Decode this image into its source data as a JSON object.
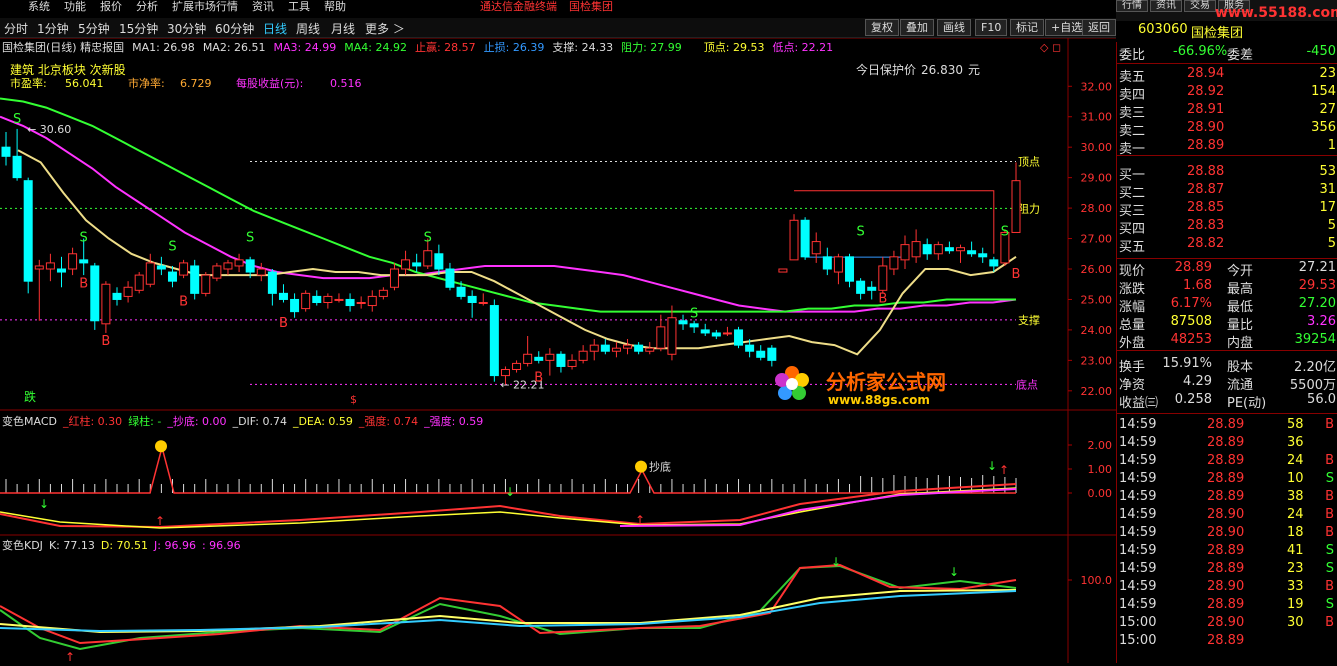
{
  "menu": {
    "items": [
      "系统",
      "功能",
      "报价",
      "分析",
      "扩展市场行情",
      "资讯",
      "工具",
      "帮助"
    ],
    "center_left": "通达信金融终端",
    "center_right": "国检集团"
  },
  "topright": {
    "buttons": [
      "行情",
      "资讯",
      "交易",
      "服务"
    ],
    "url": "www.55188.com"
  },
  "toolbar": {
    "periods": [
      "分时",
      "1分钟",
      "5分钟",
      "15分钟",
      "30分钟",
      "60分钟",
      "日线",
      "周线",
      "月线",
      "更多 ＞"
    ],
    "active": "日线",
    "right_buttons": [
      "复权",
      "叠加",
      "画线",
      "F10",
      "标记",
      "+自选",
      "返回"
    ]
  },
  "stock": {
    "code": "603060",
    "name": "国检集团"
  },
  "main_chart": {
    "legend": [
      {
        "text": "国检集团(日线) 精忠报国",
        "color": "#dddddd"
      },
      {
        "text": "MA1: 26.98",
        "color": "#dddddd"
      },
      {
        "text": "MA2: 26.51",
        "color": "#dddddd"
      },
      {
        "text": "MA3: 24.99",
        "color": "#ff33ff"
      },
      {
        "text": "MA4: 24.92",
        "color": "#33ff33"
      },
      {
        "text": "止赢: 28.57",
        "color": "#ff3333"
      },
      {
        "text": "止损: 26.39",
        "color": "#3399ff"
      },
      {
        "text": "支撑: 24.33",
        "color": "#dddddd"
      },
      {
        "text": "阻力: 27.99",
        "color": "#33ff33"
      },
      {
        "text": "顶点: 29.53",
        "color": "#ffff33"
      },
      {
        "text": "低点: 22.21",
        "color": "#ff33ff"
      }
    ],
    "info_line1": "建筑 北京板块 次新股",
    "pe_label": "市盈率:",
    "pe_value": "56.041",
    "pb_label": "市净率:",
    "pb_value": "6.729",
    "eps_label": "每股收益(元):",
    "eps_value": "0.516",
    "protect_label": "今日保护价",
    "protect_value": "26.830",
    "protect_unit": "元",
    "price_labels": {
      "high": "30.60",
      "low": "22.21",
      "top": "顶点",
      "resist": "阻力",
      "support": "支撑",
      "bottom": "底点"
    },
    "y_ticks": [
      "32.00",
      "31.00",
      "30.00",
      "29.00",
      "28.00",
      "27.00",
      "26.00",
      "25.00",
      "24.00",
      "23.00",
      "22.00"
    ],
    "fall_label": "跌"
  },
  "macd": {
    "legend": [
      {
        "text": "变色MACD",
        "color": "#dddddd"
      },
      {
        "text": "_红柱: 0.30",
        "color": "#ff3333"
      },
      {
        "text": "绿柱: -",
        "color": "#33ff33"
      },
      {
        "text": "_抄底: 0.00",
        "color": "#ff33ff"
      },
      {
        "text": "_DIF: 0.74",
        "color": "#dddddd"
      },
      {
        "text": "_DEA: 0.59",
        "color": "#ffff33"
      },
      {
        "text": "_强度: 0.74",
        "color": "#ff3333"
      },
      {
        "text": "_强度: 0.59",
        "color": "#ff33ff"
      }
    ],
    "y_ticks": [
      "2.00",
      "1.00",
      "0.00"
    ],
    "bottom_label": "抄底"
  },
  "kdj": {
    "legend": [
      {
        "text": "变色KDJ",
        "color": "#dddddd"
      },
      {
        "text": "K: 77.13",
        "color": "#dddddd"
      },
      {
        "text": "D: 70.51",
        "color": "#ffff33"
      },
      {
        "text": "J: 96.96",
        "color": "#ff33ff"
      },
      {
        "text": ": 96.96",
        "color": "#ff33ff"
      }
    ],
    "y_ticks": [
      "100.0"
    ]
  },
  "quote": {
    "ratio_label": "委比",
    "ratio_value": "-66.96%",
    "diff_label": "委差",
    "diff_value": "-450",
    "asks": [
      {
        "label": "卖五",
        "price": "28.94",
        "vol": "23"
      },
      {
        "label": "卖四",
        "price": "28.92",
        "vol": "154"
      },
      {
        "label": "卖三",
        "price": "28.91",
        "vol": "27"
      },
      {
        "label": "卖二",
        "price": "28.90",
        "vol": "356"
      },
      {
        "label": "卖一",
        "price": "28.89",
        "vol": "1"
      }
    ],
    "bids": [
      {
        "label": "买一",
        "price": "28.88",
        "vol": "53"
      },
      {
        "label": "买二",
        "price": "28.87",
        "vol": "31"
      },
      {
        "label": "买三",
        "price": "28.85",
        "vol": "17"
      },
      {
        "label": "买四",
        "price": "28.83",
        "vol": "5"
      },
      {
        "label": "买五",
        "price": "28.82",
        "vol": "5"
      }
    ],
    "stats": [
      {
        "l1": "现价",
        "v1": "28.89",
        "c1": "#ff3333",
        "l2": "今开",
        "v2": "27.21",
        "c2": "#dddddd"
      },
      {
        "l1": "涨跌",
        "v1": "1.68",
        "c1": "#ff3333",
        "l2": "最高",
        "v2": "29.53",
        "c2": "#ff3333"
      },
      {
        "l1": "涨幅",
        "v1": "6.17%",
        "c1": "#ff3333",
        "l2": "最低",
        "v2": "27.20",
        "c2": "#33ff33"
      },
      {
        "l1": "总量",
        "v1": "87508",
        "c1": "#ffff33",
        "l2": "量比",
        "v2": "3.26",
        "c2": "#ff33ff"
      },
      {
        "l1": "外盘",
        "v1": "48253",
        "c1": "#ff3333",
        "l2": "内盘",
        "v2": "39254",
        "c2": "#33ff33"
      }
    ],
    "stats2": [
      {
        "l1": "换手",
        "v1": "15.91%",
        "l2": "股本",
        "v2": "2.20亿"
      },
      {
        "l1": "净资",
        "v1": "4.29",
        "l2": "流通",
        "v2": "5500万"
      },
      {
        "l1": "收益㈢",
        "v1": "0.258",
        "l2": "PE(动)",
        "v2": "56.0"
      }
    ],
    "ticks": [
      {
        "time": "14:59",
        "price": "28.89",
        "vol": "58",
        "side": "B"
      },
      {
        "time": "14:59",
        "price": "28.89",
        "vol": "36",
        "side": ""
      },
      {
        "time": "14:59",
        "price": "28.89",
        "vol": "24",
        "side": "B"
      },
      {
        "time": "14:59",
        "price": "28.89",
        "vol": "10",
        "side": "S"
      },
      {
        "time": "14:59",
        "price": "28.89",
        "vol": "38",
        "side": "B"
      },
      {
        "time": "14:59",
        "price": "28.90",
        "vol": "24",
        "side": "B"
      },
      {
        "time": "14:59",
        "price": "28.90",
        "vol": "18",
        "side": "B"
      },
      {
        "time": "14:59",
        "price": "28.89",
        "vol": "41",
        "side": "S"
      },
      {
        "time": "14:59",
        "price": "28.89",
        "vol": "23",
        "side": "S"
      },
      {
        "time": "14:59",
        "price": "28.90",
        "vol": "33",
        "side": "B"
      },
      {
        "time": "14:59",
        "price": "28.89",
        "vol": "19",
        "side": "S"
      },
      {
        "time": "15:00",
        "price": "28.90",
        "vol": "30",
        "side": "B"
      },
      {
        "time": "15:00",
        "price": "28.89",
        "vol": "",
        "side": ""
      }
    ]
  },
  "watermark": {
    "title": "分析家公式网",
    "url": "www.88gs.com"
  },
  "chart_data": {
    "type": "candlestick",
    "ylim": [
      21.6,
      32.6
    ],
    "candles": [
      [
        30.0,
        30.5,
        29.4,
        29.7
      ],
      [
        29.7,
        30.6,
        28.9,
        29.0
      ],
      [
        28.9,
        29.0,
        25.2,
        25.6
      ],
      [
        26.0,
        26.3,
        24.3,
        26.1
      ],
      [
        26.0,
        26.5,
        25.6,
        26.2
      ],
      [
        26.0,
        26.4,
        25.4,
        25.9
      ],
      [
        26.0,
        26.7,
        25.8,
        26.5
      ],
      [
        26.3,
        27.0,
        25.8,
        26.2
      ],
      [
        26.1,
        26.2,
        24.0,
        24.3
      ],
      [
        24.2,
        25.6,
        23.9,
        25.5
      ],
      [
        25.2,
        25.4,
        24.8,
        25.0
      ],
      [
        25.1,
        25.6,
        24.9,
        25.4
      ],
      [
        25.3,
        25.9,
        25.2,
        25.8
      ],
      [
        25.5,
        26.5,
        25.4,
        26.2
      ],
      [
        26.1,
        26.4,
        25.8,
        26.0
      ],
      [
        25.9,
        26.1,
        25.4,
        25.6
      ],
      [
        25.8,
        26.3,
        25.7,
        26.2
      ],
      [
        26.1,
        26.3,
        25.0,
        25.2
      ],
      [
        25.2,
        25.9,
        25.1,
        25.8
      ],
      [
        25.7,
        26.2,
        25.6,
        26.1
      ],
      [
        26.0,
        26.3,
        25.8,
        26.2
      ],
      [
        26.1,
        26.5,
        25.9,
        26.3
      ],
      [
        26.3,
        26.4,
        25.7,
        25.9
      ],
      [
        25.8,
        26.2,
        25.6,
        26.0
      ],
      [
        25.9,
        26.0,
        24.8,
        25.2
      ],
      [
        25.2,
        25.5,
        24.9,
        25.0
      ],
      [
        25.0,
        25.2,
        24.4,
        24.6
      ],
      [
        24.7,
        25.3,
        24.6,
        25.2
      ],
      [
        25.1,
        25.3,
        24.8,
        24.9
      ],
      [
        24.9,
        25.2,
        24.7,
        25.1
      ],
      [
        25.0,
        25.2,
        24.9,
        25.0
      ],
      [
        25.0,
        25.2,
        24.6,
        24.8
      ],
      [
        24.9,
        25.1,
        24.7,
        24.9
      ],
      [
        24.8,
        25.3,
        24.6,
        25.1
      ],
      [
        25.1,
        25.4,
        25.0,
        25.3
      ],
      [
        25.4,
        26.2,
        25.3,
        26.0
      ],
      [
        26.0,
        26.6,
        25.8,
        26.3
      ],
      [
        26.2,
        26.5,
        25.9,
        26.1
      ],
      [
        26.1,
        27.0,
        26.0,
        26.6
      ],
      [
        26.5,
        26.8,
        25.8,
        26.0
      ],
      [
        26.0,
        26.2,
        25.3,
        25.4
      ],
      [
        25.4,
        25.6,
        25.0,
        25.1
      ],
      [
        25.1,
        25.3,
        24.4,
        24.9
      ],
      [
        24.9,
        25.2,
        24.8,
        24.9
      ],
      [
        24.8,
        25.0,
        22.3,
        22.5
      ],
      [
        22.5,
        22.8,
        22.2,
        22.7
      ],
      [
        22.7,
        23.0,
        22.6,
        22.9
      ],
      [
        22.9,
        23.8,
        22.8,
        23.2
      ],
      [
        23.1,
        23.3,
        22.9,
        23.0
      ],
      [
        23.0,
        23.4,
        22.5,
        23.2
      ],
      [
        23.2,
        23.3,
        22.6,
        22.8
      ],
      [
        22.8,
        23.2,
        22.7,
        23.0
      ],
      [
        23.0,
        23.5,
        22.9,
        23.3
      ],
      [
        23.3,
        23.7,
        23.0,
        23.5
      ],
      [
        23.5,
        23.7,
        23.2,
        23.3
      ],
      [
        23.3,
        23.6,
        23.1,
        23.4
      ],
      [
        23.4,
        23.7,
        23.2,
        23.5
      ],
      [
        23.5,
        23.6,
        23.2,
        23.3
      ],
      [
        23.3,
        23.6,
        23.2,
        23.4
      ],
      [
        23.4,
        24.5,
        23.3,
        24.1
      ],
      [
        23.2,
        24.8,
        23.0,
        24.4
      ],
      [
        24.3,
        24.5,
        24.0,
        24.2
      ],
      [
        24.2,
        24.3,
        23.9,
        24.1
      ],
      [
        24.0,
        24.2,
        23.8,
        23.9
      ],
      [
        23.9,
        24.0,
        23.7,
        23.8
      ],
      [
        23.9,
        24.1,
        23.8,
        23.9
      ],
      [
        24.0,
        24.1,
        23.4,
        23.5
      ],
      [
        23.5,
        23.7,
        23.1,
        23.3
      ],
      [
        23.3,
        23.5,
        23.0,
        23.1
      ],
      [
        23.4,
        23.5,
        22.8,
        23.0
      ],
      [
        25.9,
        26.0,
        25.9,
        26.0
      ],
      [
        26.3,
        27.8,
        26.3,
        27.6
      ],
      [
        27.6,
        27.7,
        26.3,
        26.4
      ],
      [
        26.5,
        27.2,
        26.2,
        26.9
      ],
      [
        26.4,
        26.7,
        25.8,
        26.0
      ],
      [
        25.9,
        26.5,
        25.5,
        26.4
      ],
      [
        26.4,
        26.5,
        25.4,
        25.6
      ],
      [
        25.6,
        25.7,
        25.0,
        25.2
      ],
      [
        25.4,
        25.6,
        25.0,
        25.3
      ],
      [
        25.3,
        26.4,
        25.2,
        26.1
      ],
      [
        26.0,
        26.6,
        25.8,
        26.4
      ],
      [
        26.3,
        27.1,
        26.0,
        26.8
      ],
      [
        26.4,
        27.3,
        26.2,
        26.9
      ],
      [
        26.8,
        27.0,
        26.3,
        26.5
      ],
      [
        26.5,
        26.9,
        26.3,
        26.8
      ],
      [
        26.7,
        26.9,
        26.5,
        26.6
      ],
      [
        26.6,
        26.8,
        26.2,
        26.7
      ],
      [
        26.6,
        26.9,
        26.4,
        26.5
      ],
      [
        26.5,
        26.7,
        26.2,
        26.4
      ],
      [
        26.3,
        26.4,
        25.9,
        26.1
      ],
      [
        26.2,
        27.3,
        26.1,
        27.2
      ],
      [
        27.2,
        29.5,
        27.2,
        28.9
      ]
    ],
    "ma_lines": [
      {
        "name": "MA3",
        "color": "#ff33ff",
        "values": [
          31.0,
          30.7,
          30.3,
          29.8,
          29.3,
          28.7,
          28.2,
          27.7,
          27.2,
          26.8,
          26.4,
          26.1,
          25.9,
          25.8,
          25.7,
          25.7,
          25.7,
          25.8,
          25.8,
          25.9,
          26.0,
          26.1,
          26.1,
          26.1,
          26.1,
          26.0,
          25.9,
          25.8,
          25.6,
          25.4,
          25.2,
          25.0,
          24.8,
          24.7,
          24.6,
          24.6,
          24.6,
          24.6,
          24.7,
          24.7,
          24.8,
          24.8,
          24.9,
          24.9,
          25.0
        ]
      },
      {
        "name": "MA4",
        "color": "#33ff33",
        "values": [
          31.6,
          31.5,
          31.3,
          31.0,
          30.7,
          30.3,
          29.9,
          29.5,
          29.1,
          28.7,
          28.3,
          27.9,
          27.6,
          27.3,
          27.0,
          26.7,
          26.4,
          26.2,
          25.9,
          25.7,
          25.5,
          25.3,
          25.1,
          24.9,
          24.8,
          24.7,
          24.6,
          24.6,
          24.6,
          24.6,
          24.6,
          24.6,
          24.6,
          24.6,
          24.6,
          24.7,
          24.7,
          24.8,
          24.8,
          24.9,
          24.9,
          25.0,
          25.0,
          25.0,
          25.0
        ]
      }
    ],
    "ma_small": {
      "name": "MA1",
      "color": "#eedd88",
      "values": [
        29.9,
        29.5,
        28.5,
        27.6,
        27.0,
        26.5,
        26.2,
        26.0,
        25.8,
        25.8,
        25.8,
        25.8,
        25.9,
        26.0,
        25.9,
        25.9,
        25.8,
        25.8,
        25.8,
        25.9,
        25.9,
        25.6,
        25.2,
        24.8,
        24.4,
        24.0,
        23.7,
        23.5,
        23.4,
        23.4,
        23.4,
        23.5,
        23.6,
        23.7,
        23.8,
        23.6,
        23.5,
        23.2,
        24.0,
        25.2,
        26.0,
        26.0,
        25.8,
        25.9,
        26.4
      ]
    },
    "support": 24.33,
    "resist": 27.99,
    "top": 29.53,
    "bottom": 22.21
  }
}
